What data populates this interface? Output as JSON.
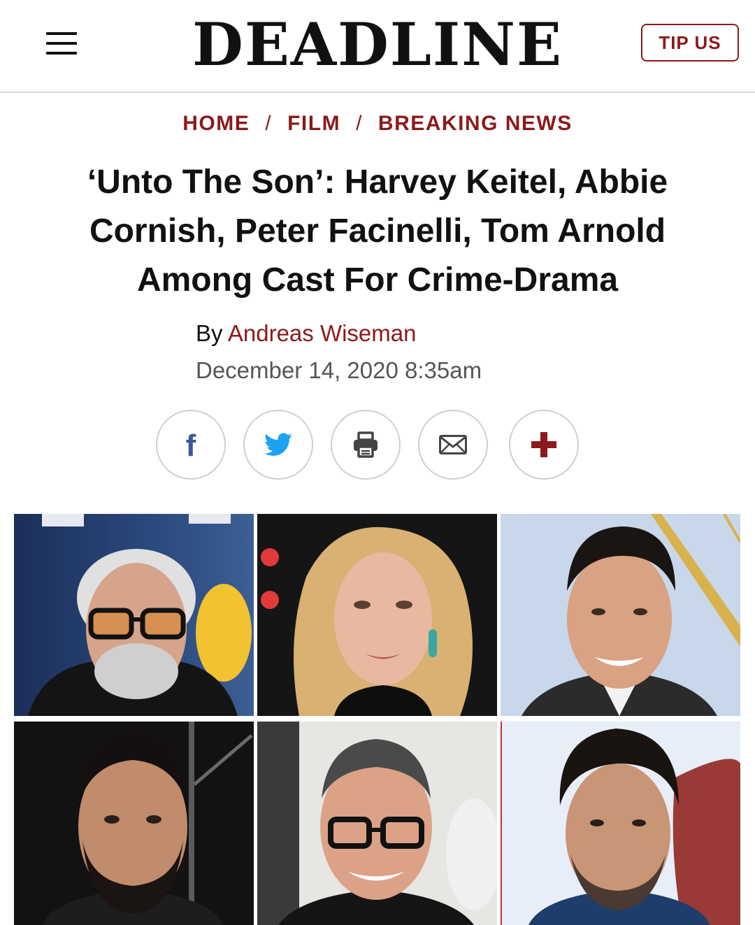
{
  "header": {
    "logo": "DEADLINE",
    "tip_label": "TIP US"
  },
  "breadcrumb": {
    "items": [
      "HOME",
      "FILM",
      "BREAKING NEWS"
    ],
    "separator": "/"
  },
  "article": {
    "headline": "‘Unto The Son’: Harvey Keitel, Abbie Cornish, Peter Facinelli, Tom Arnold Among Cast For Crime-Drama",
    "by_prefix": "By",
    "author": "Andreas Wiseman",
    "date": "December 14, 2020 8:35am"
  },
  "share_buttons": [
    "facebook-icon",
    "twitter-icon",
    "print-icon",
    "email-icon",
    "plus-icon"
  ],
  "colors": {
    "brand_red": "#8b1a1a",
    "facebook_blue": "#3b5998",
    "twitter_blue": "#1da1f2",
    "divider": "#d9d9d9"
  },
  "photos": [
    "headshot-photo",
    "headshot-photo",
    "headshot-photo",
    "headshot-photo",
    "headshot-photo",
    "headshot-photo"
  ]
}
